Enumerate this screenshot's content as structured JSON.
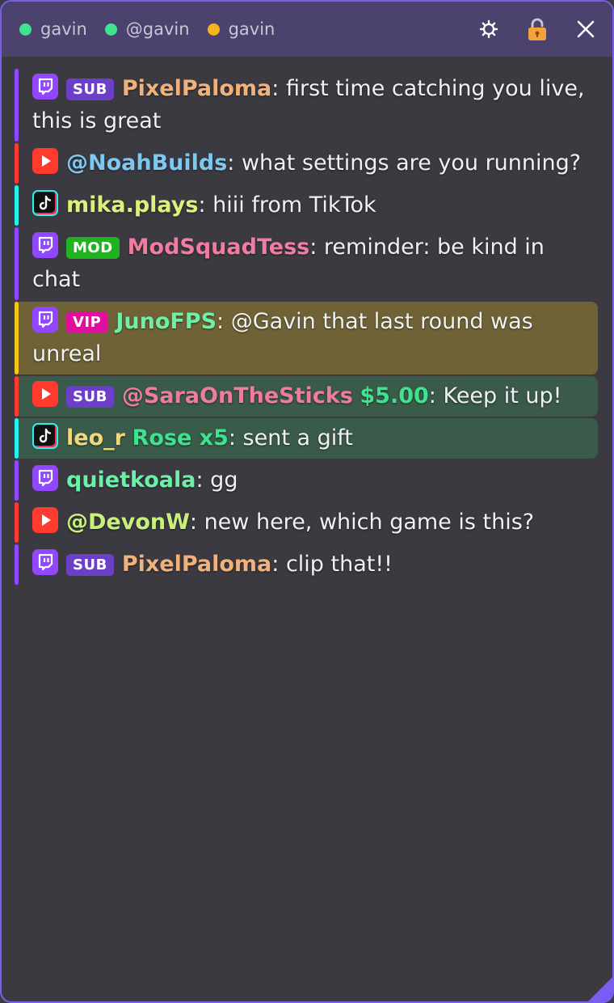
{
  "header": {
    "accounts": [
      {
        "name": "gavin",
        "color": "#3ee28f",
        "platform": "twitch"
      },
      {
        "name": "@gavin",
        "color": "#3ee28f",
        "platform": "youtube"
      },
      {
        "name": "gavin",
        "color": "#f7b41a",
        "platform": "tiktok"
      }
    ],
    "icons": [
      "gear-icon",
      "lock-icon",
      "close-icon"
    ]
  },
  "platform_colors": {
    "twitch": "#9147ff",
    "youtube": "#ff3b30",
    "tiktok": "#25f4ee"
  },
  "messages": [
    {
      "platform": "twitch",
      "badge": "SUB",
      "user": "PixelPaloma",
      "user_color": "#f0b27a",
      "text": ": first time catching you live, this is great"
    },
    {
      "platform": "youtube",
      "user": "@NoahBuilds",
      "user_color": "#7ec8f0",
      "text": ": what settings are you running?"
    },
    {
      "platform": "tiktok",
      "user": "mika.plays",
      "user_color": "#dcf07c",
      "text": ": hiii from TikTok"
    },
    {
      "platform": "twitch",
      "badge": "MOD",
      "user": "ModSquadTess",
      "user_color": "#f07ca0",
      "text": ": reminder: be kind in chat"
    },
    {
      "platform": "twitch",
      "badge": "VIP",
      "user": "JunoFPS",
      "user_color": "#6cf0a8",
      "text": ": @Gavin that last round was unreal",
      "highlight": "vip"
    },
    {
      "platform": "youtube",
      "badge": "SUB",
      "user": "@SaraOnTheSticks",
      "user_color": "#f07c9c",
      "amount": "$5.00",
      "text": ": Keep it up!",
      "highlight": "donation"
    },
    {
      "platform": "tiktok",
      "user": "leo_r",
      "user_color": "#f0d87c",
      "gift": "Rose x5",
      "text": ": sent a gift",
      "highlight": "donation"
    },
    {
      "platform": "twitch",
      "user": "quietkoala",
      "user_color": "#6cf0a8",
      "text": ": gg"
    },
    {
      "platform": "youtube",
      "user": "@DevonW",
      "user_color": "#c8f07c",
      "text": ": new here, which game is this?"
    },
    {
      "platform": "twitch",
      "badge": "SUB",
      "user": "PixelPaloma",
      "user_color": "#f0b27a",
      "text": ": clip that!!"
    }
  ]
}
